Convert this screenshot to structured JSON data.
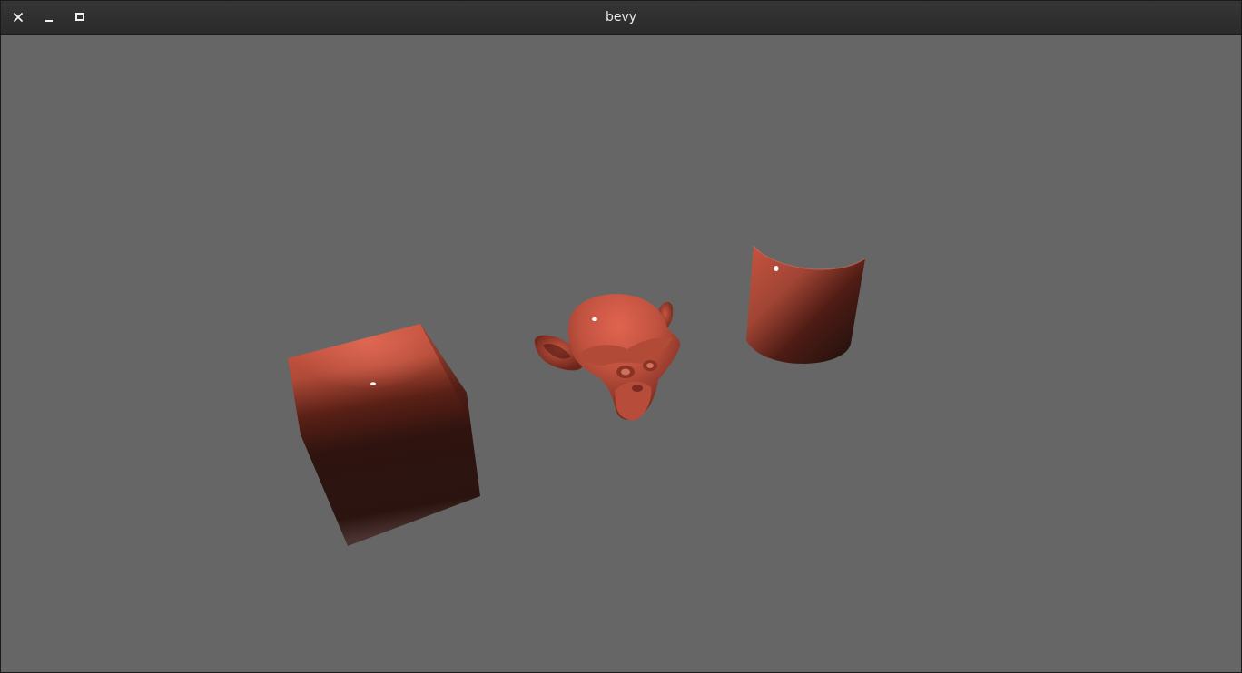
{
  "window": {
    "title": "bevy",
    "buttons": {
      "close_icon": "close-icon",
      "minimize_icon": "minimize-icon",
      "maximize_icon": "maximize-icon"
    }
  },
  "scene": {
    "background_color": "#666666",
    "material_color": "#c0523f",
    "objects": [
      "cube",
      "monkey-head",
      "cylinder"
    ]
  }
}
